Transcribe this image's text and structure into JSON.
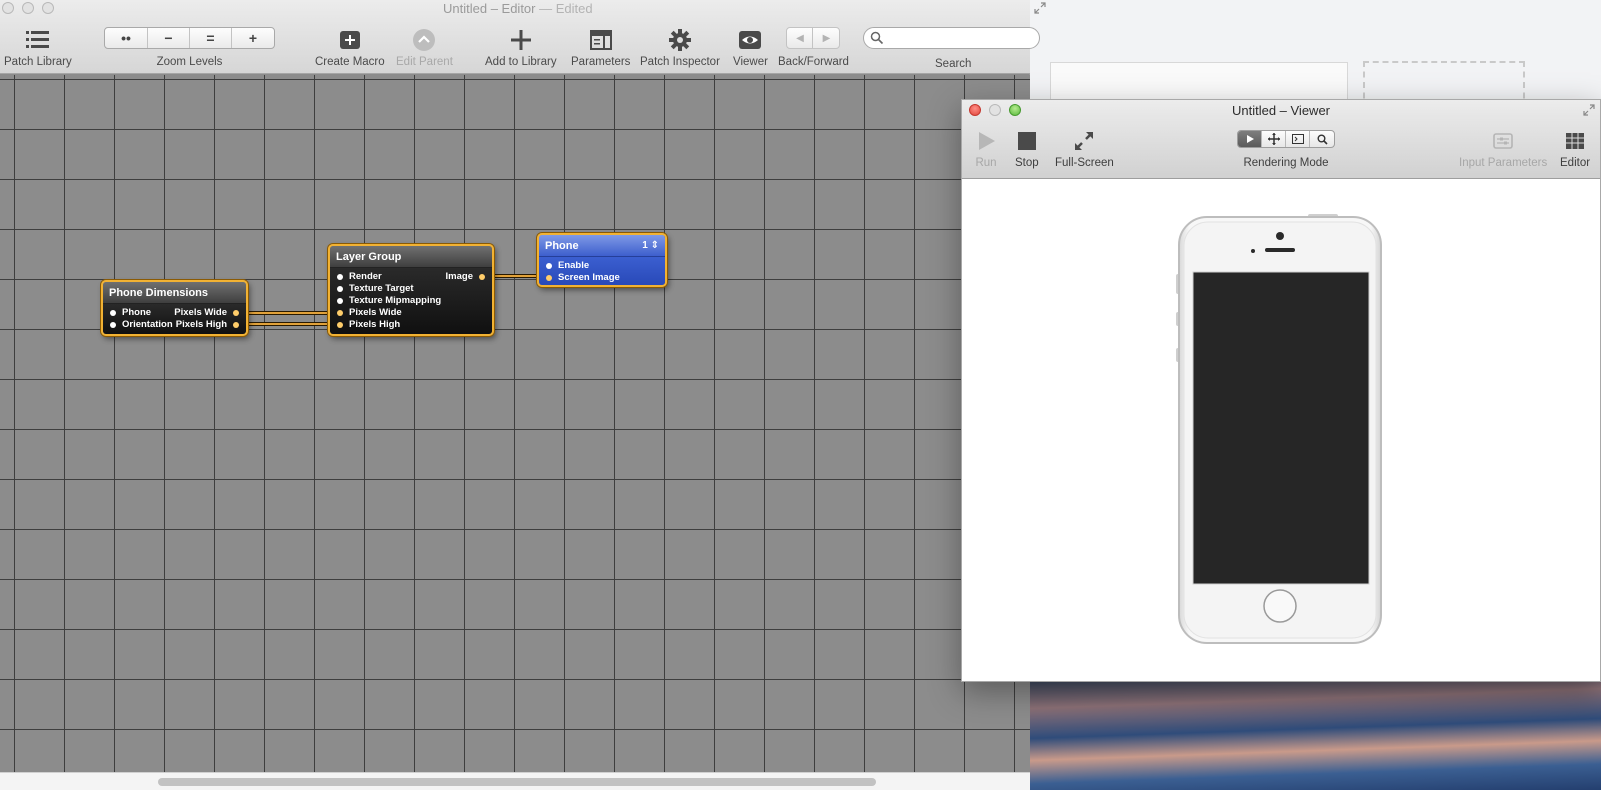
{
  "editor": {
    "title": "Untitled – Editor",
    "title_suffix": "— Edited",
    "toolbar": {
      "patch_library": "Patch Library",
      "zoom_levels": "Zoom Levels",
      "zoom_buttons": [
        "••",
        "−",
        "=",
        "+"
      ],
      "create_macro": "Create Macro",
      "edit_parent": "Edit Parent",
      "add_to_library": "Add to Library",
      "parameters": "Parameters",
      "patch_inspector": "Patch Inspector",
      "viewer": "Viewer",
      "back_forward": "Back/Forward",
      "search_label": "Search",
      "search_placeholder": ""
    },
    "patches": {
      "phone_dimensions": {
        "title": "Phone Dimensions",
        "inputs": [
          "Phone",
          "Orientation"
        ],
        "outputs": [
          "Pixels Wide",
          "Pixels High"
        ]
      },
      "layer_group": {
        "title": "Layer Group",
        "inputs": [
          "Render",
          "Texture Target",
          "Texture Mipmapping",
          "Pixels Wide",
          "Pixels High"
        ],
        "outputs": [
          "Image"
        ]
      },
      "phone": {
        "title": "Phone",
        "index": "1 ⇕",
        "inputs": [
          "Enable",
          "Screen Image"
        ]
      }
    }
  },
  "viewer": {
    "title": "Untitled – Viewer",
    "toolbar": {
      "run": "Run",
      "stop": "Stop",
      "full_screen": "Full-Screen",
      "rendering_mode": "Rendering Mode",
      "input_parameters": "Input Parameters",
      "editor": "Editor"
    }
  },
  "colors": {
    "patch_border": "#f2b233",
    "patch_blue": "#3d5fcd",
    "canvas_bg": "#8c8c8c",
    "grid_line": "#3e3e3e",
    "wire": "#e2a23a"
  },
  "icons": {
    "patch_library": "list-icon",
    "create_macro": "plus-box-icon",
    "edit_parent": "up-arrow-circle-icon",
    "add_to_library": "plus-icon",
    "parameters": "panel-icon",
    "patch_inspector": "gear-icon",
    "viewer": "eye-icon",
    "back_forward": "arrows-icon",
    "search": "magnifier-icon",
    "run": "play-icon",
    "stop": "stop-icon",
    "full_screen": "expand-icon",
    "input_parameters": "sliders-icon",
    "editor": "grid-icon"
  }
}
